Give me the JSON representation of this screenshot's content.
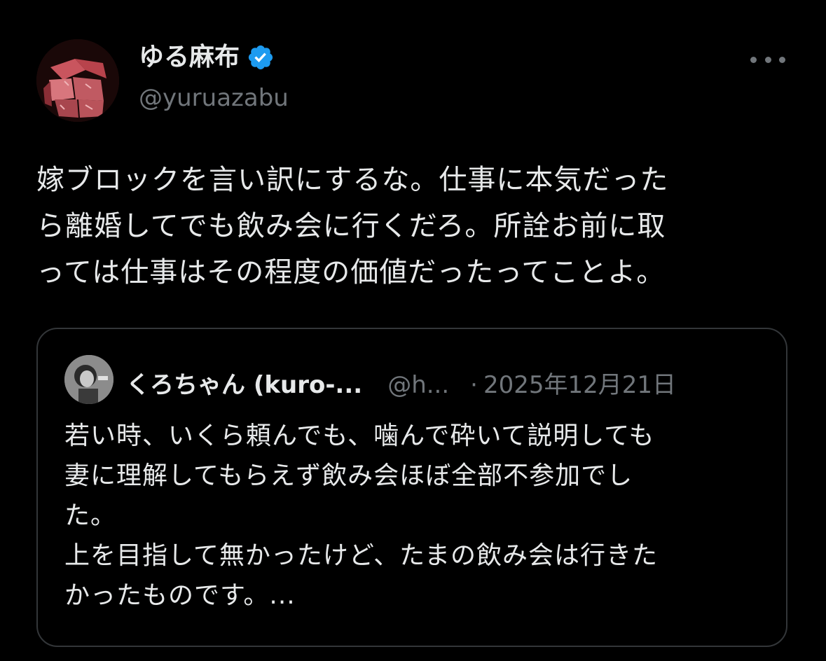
{
  "tweet": {
    "author": {
      "display_name": "ゆる麻布",
      "handle": "@yuruazabu",
      "verified": true,
      "avatar_icon": "meat-photo-avatar"
    },
    "more_icon": "more-dots-icon",
    "text": "嫁ブロックを言い訳にするな。仕事に本気だった\nら離婚してでも飲み会に行くだろ。所詮お前に取\nっては仕事はその程度の価値だったってことよ。"
  },
  "quoted_tweet": {
    "author": {
      "display_name": "くろちゃん (kuro-...",
      "handle": "@h...",
      "avatar_icon": "person-photo-avatar"
    },
    "separator": "·",
    "date": "2025年12月21日",
    "text": "若い時、いくら頼んでも、噛んで砕いて説明しても\n妻に理解してもらえず飲み会ほぼ全部不参加でし\nた。\n上を目指して無かったけど、たまの飲み会は行きた\nかったものです。..."
  },
  "colors": {
    "background": "#000000",
    "primary_text": "#e7e9ea",
    "secondary_text": "#71767b",
    "verified_badge": "#1d9bf0",
    "border": "#333639"
  }
}
